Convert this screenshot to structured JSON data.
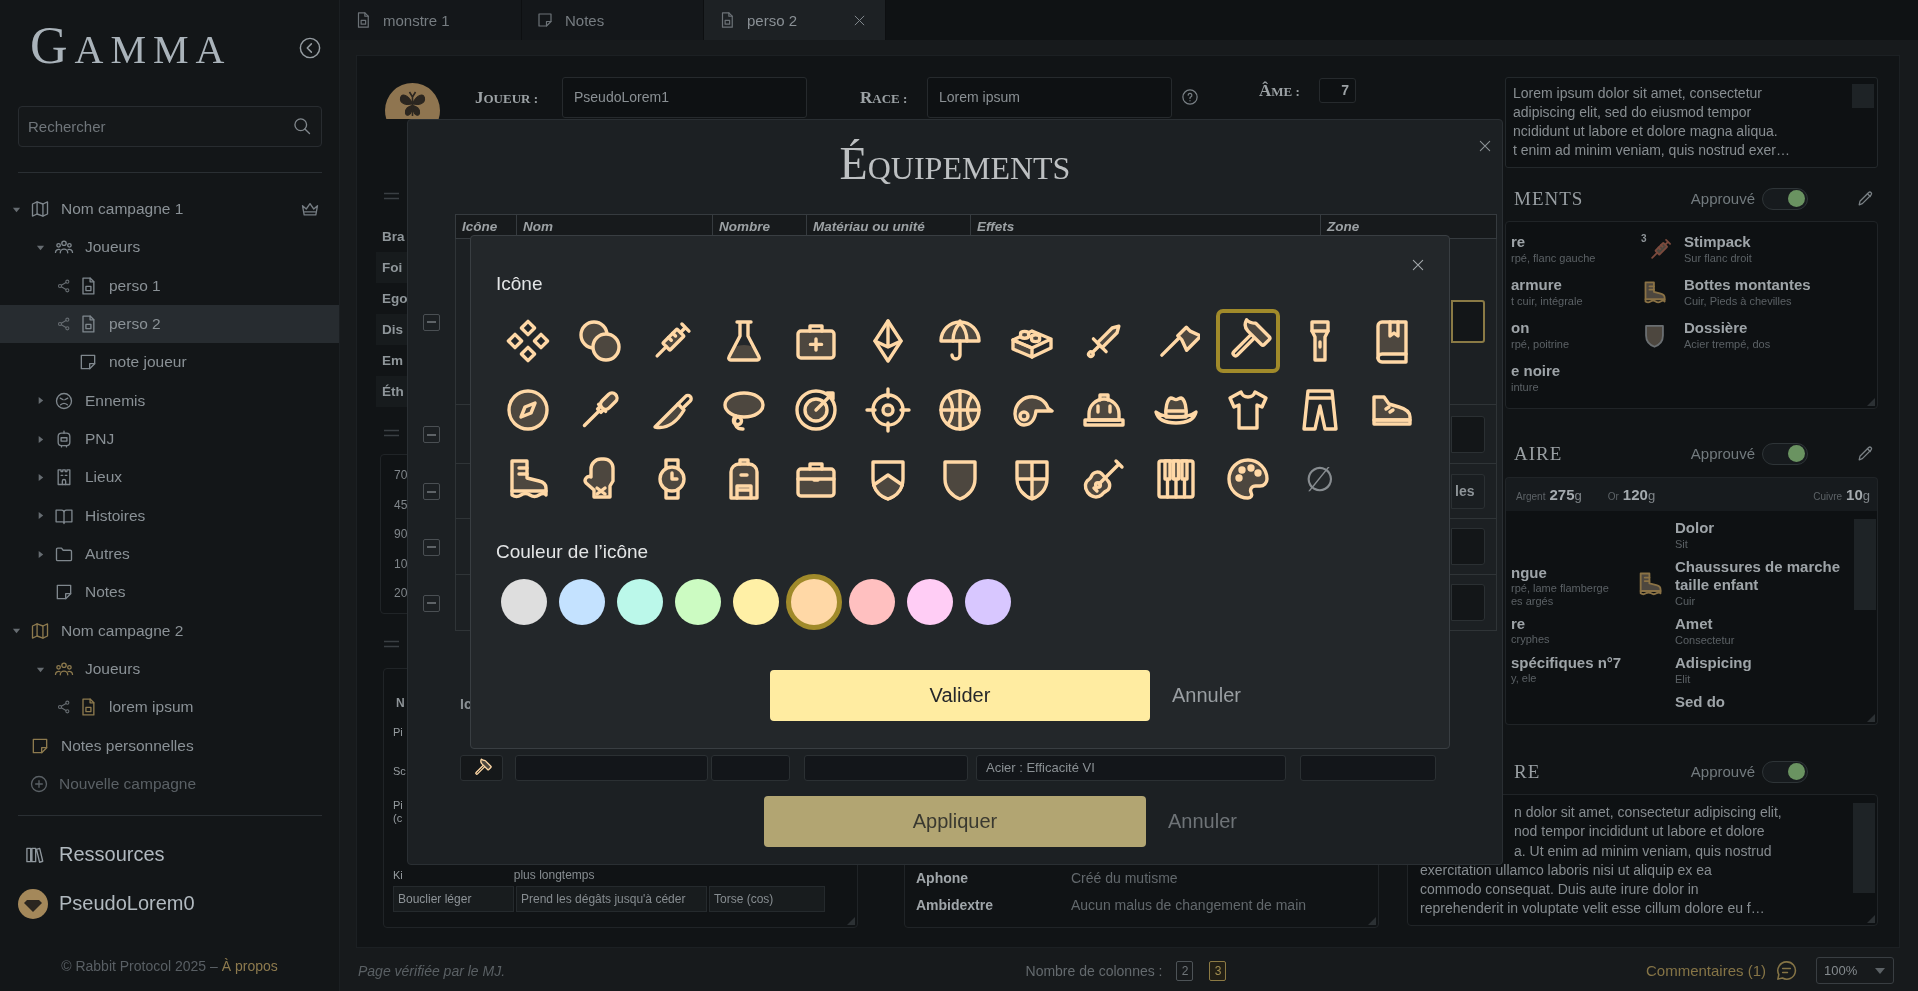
{
  "sidebar": {
    "logo": "GAMMA",
    "search": {
      "placeholder": "Rechercher"
    },
    "tree": [
      {
        "label": "Nom campagne 1",
        "kind": "campaign",
        "expanded": true,
        "selected": false,
        "accent": false,
        "owner": true,
        "children": [
          {
            "label": "Joueurs",
            "kind": "players",
            "expanded": true,
            "selected": false,
            "accent": false,
            "children": [
              {
                "label": "perso 1",
                "kind": "sheet",
                "selected": false,
                "accent": false,
                "shared": true
              },
              {
                "label": "perso 2",
                "kind": "sheet",
                "selected": true,
                "accent": false,
                "shared": true
              },
              {
                "label": "note joueur",
                "kind": "note",
                "selected": false,
                "accent": false,
                "shared": false
              }
            ]
          },
          {
            "label": "Ennemis",
            "kind": "enemies",
            "expanded": false,
            "selected": false,
            "accent": false
          },
          {
            "label": "PNJ",
            "kind": "npcs",
            "expanded": false,
            "selected": false,
            "accent": false
          },
          {
            "label": "Lieux",
            "kind": "places",
            "expanded": false,
            "selected": false,
            "accent": false
          },
          {
            "label": "Histoires",
            "kind": "stories",
            "expanded": false,
            "selected": false,
            "accent": false
          },
          {
            "label": "Autres",
            "kind": "others",
            "expanded": false,
            "selected": false,
            "accent": false
          },
          {
            "label": "Notes",
            "kind": "note",
            "selected": false,
            "accent": false,
            "shared": false
          }
        ]
      },
      {
        "label": "Nom campagne 2",
        "kind": "campaign",
        "expanded": true,
        "selected": false,
        "accent": true,
        "owner": false,
        "children": [
          {
            "label": "Joueurs",
            "kind": "players",
            "expanded": true,
            "selected": false,
            "accent": true,
            "children": [
              {
                "label": "lorem ipsum",
                "kind": "sheet",
                "selected": false,
                "accent": true,
                "shared": true
              }
            ]
          }
        ]
      },
      {
        "label": "Notes personnelles",
        "kind": "note",
        "selected": false,
        "accent": true,
        "shared": false
      }
    ],
    "new_campaign": "Nouvelle campagne",
    "resources": "Ressources",
    "user": "PseudoLorem0",
    "footer": {
      "text": "© Rabbit Protocol 2025 –",
      "link": "À propos"
    }
  },
  "tabs": [
    {
      "label": "monstre 1",
      "kind": "sheet",
      "selected": false
    },
    {
      "label": "Notes",
      "kind": "note",
      "selected": false
    },
    {
      "label": "perso 2",
      "kind": "sheet",
      "selected": true
    }
  ],
  "sheet": {
    "player": {
      "label": "JOUEUR :",
      "value": "PseudoLorem1"
    },
    "race": {
      "label": "RACE :",
      "value": "Lorem ipsum"
    },
    "soul": {
      "label": "ÂME :",
      "value": "7"
    },
    "attributes": [
      "Bra",
      "Foi",
      "Ego",
      "Dis",
      "Em",
      "Éth"
    ],
    "stats": [
      "70",
      "45",
      "90",
      "10",
      "20"
    ],
    "gear_table": {
      "header": "N",
      "rows": [
        {
          "name": "Pi"
        },
        {
          "name": "Sc"
        },
        {
          "name": "Pi (c"
        },
        {
          "name": "Ki",
          "effect": "plus longtemps"
        },
        {
          "name": "Bouclier léger",
          "effect": "Prend les dégâts jusqu'à céder",
          "zone": "Torse (cos)"
        }
      ]
    },
    "traits": [
      {
        "name": "Aphone",
        "effect": "Créé du mutisme"
      },
      {
        "name": "Ambidextre",
        "effect": "Aucun malus de changement de main"
      }
    ],
    "description": [
      "Lorem ipsum dolor sit amet, consectetur",
      "adipiscing elit, sed do eiusmod  tempor",
      "ncididunt ut labore et dolore magna aliqua.",
      "t enim ad minim  veniam, quis nostrud exer…"
    ],
    "equipment": {
      "title": "MENTS",
      "approved_label": "Approuvé",
      "approved": true,
      "editable": true,
      "left": [
        {
          "name": "re",
          "detail": "rpé, flanc gauche"
        },
        {
          "name": "armure",
          "detail": "t cuir, intégrale"
        },
        {
          "name": "on",
          "detail": "rpé, poitrine"
        },
        {
          "name": "e noire",
          "detail": "inture"
        }
      ],
      "right": [
        {
          "name": "Stimpack",
          "detail": "Sur flanc droit",
          "count": "3",
          "color": "#7b4a3d"
        },
        {
          "name": "Bottes montantes",
          "detail": "Cuir, Pieds à chevilles",
          "color": "#8a7245"
        },
        {
          "name": "Dossière",
          "detail": "Acier trempé, dos",
          "color": "#6a6f72"
        }
      ]
    },
    "inventory": {
      "title": "AIRE",
      "approved_label": "Approuvé",
      "approved": true,
      "editable": true,
      "money": [
        {
          "label": "Argent",
          "amount": "**275**g"
        },
        {
          "label": "Or",
          "amount": "**120**g"
        },
        {
          "label": "Cuivre",
          "amount": "**10**g"
        }
      ],
      "left": [
        {
          "name": "ngue",
          "details": [
            "rpé, lame flamberge",
            "es argés"
          ]
        },
        {
          "name": "re",
          "details": [
            "cryphes"
          ]
        },
        {
          "name": "spécifiques n°7",
          "details": [
            "y, ele"
          ]
        }
      ],
      "right": [
        {
          "name": "Dolor",
          "detail": "Sit"
        },
        {
          "name": "Chaussures de marche taille enfant",
          "detail": "Cuir",
          "color": "#8a7245"
        },
        {
          "name": "Amet",
          "detail": "Consectetur"
        },
        {
          "name": "Adispicing",
          "detail": "Elit"
        },
        {
          "name": "Sed do"
        }
      ]
    },
    "story": {
      "title": "RE",
      "approved_label": "Approuvé",
      "approved": true,
      "editable": false,
      "lines": [
        "n dolor sit amet, consectetur adipiscing elit,",
        "nod  tempor incididunt ut labore et dolore",
        "a. Ut enim ad minim  veniam, quis nostrud",
        "exercitation ullamco laboris nisi ut aliquip ex ea",
        "commodo consequat. Duis aute irure dolor in",
        "reprehenderit in voluptate  velit esse cillum dolore eu f…"
      ]
    }
  },
  "bottom_bar": {
    "verified": "Page vérifiée par le MJ.",
    "columns_label": "Nombre de colonnes :",
    "column_options": [
      {
        "label": "2",
        "selected": false
      },
      {
        "label": "3",
        "selected": true
      }
    ],
    "comments": "Commentaires (1)",
    "zoom": "100%"
  },
  "equipment_dialog": {
    "title": "ÉQUIPEMENTS",
    "columns": [
      "Icône",
      "Nom",
      "Nombre",
      "Matériau ou unité",
      "Effets",
      "Zone"
    ],
    "rows": [
      {
        "kind": "field",
        "focused": true
      },
      {
        "kind": "field",
        "focused": false
      },
      {
        "kind": "button",
        "label": "les",
        "focused": false
      },
      {
        "kind": "field",
        "focused": false
      },
      {
        "kind": "field",
        "focused": false
      }
    ],
    "new_item": {
      "icon_label": "Ic",
      "effects": "Acier : Efficacité VI"
    },
    "apply": "Appliquer",
    "cancel": "Annuler"
  },
  "icon_dialog": {
    "icon_label": "Icône",
    "icons": [
      {
        "selected": false
      },
      {
        "selected": false
      },
      {
        "selected": false
      },
      {
        "selected": false
      },
      {
        "selected": false
      },
      {
        "selected": false
      },
      {
        "selected": false
      },
      {
        "selected": false
      },
      {
        "selected": false
      },
      {
        "selected": false
      },
      {
        "selected": true
      },
      {
        "selected": false
      },
      {
        "selected": false
      },
      {
        "selected": false
      },
      {
        "selected": false
      },
      {
        "selected": false
      },
      {
        "selected": false
      },
      {
        "selected": false
      },
      {
        "selected": false
      },
      {
        "selected": false
      },
      {
        "selected": false
      },
      {
        "selected": false
      },
      {
        "selected": false
      },
      {
        "selected": false
      },
      {
        "selected": false
      },
      {
        "selected": false
      },
      {
        "selected": false
      },
      {
        "selected": false
      },
      {
        "selected": false
      },
      {
        "selected": false
      },
      {
        "selected": false
      },
      {
        "selected": false
      },
      {
        "selected": false
      },
      {
        "selected": false
      },
      {
        "selected": false
      },
      {
        "selected": false
      },
      {
        "selected": false
      }
    ],
    "no_icon": {
      "symbol": "∅",
      "selected": false
    },
    "color_label": "Couleur de l’icône",
    "colors": [
      {
        "color": "#dedede",
        "selected": false
      },
      {
        "color": "#c4e2ff",
        "selected": false
      },
      {
        "color": "#bbf8ea",
        "selected": false
      },
      {
        "color": "#ccfbc2",
        "selected": false
      },
      {
        "color": "#fff0a6",
        "selected": false
      },
      {
        "color": "#ffd8a6",
        "selected": true
      },
      {
        "color": "#ffc0c0",
        "selected": false
      },
      {
        "color": "#ffcdf5",
        "selected": false
      },
      {
        "color": "#d8c7ff",
        "selected": false
      }
    ],
    "confirm": "Valider",
    "cancel": "Annuler"
  }
}
